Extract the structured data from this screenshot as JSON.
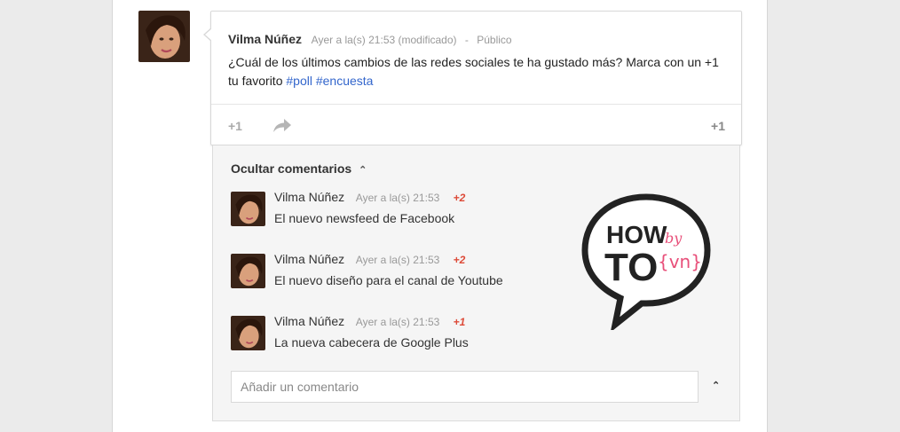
{
  "post": {
    "author": "Vilma Núñez",
    "timestamp": "Ayer a la(s) 21:53 (modificado)",
    "separator": "-",
    "visibility": "Público",
    "text_plain": "¿Cuál de los últimos cambios de las redes sociales te ha gustado más? Marca con un +1 tu favorito",
    "hashtags": [
      "#poll",
      "#encuesta"
    ],
    "plus_one_label": "+1",
    "share_icon": "share-arrow-icon",
    "plus_count": "+1"
  },
  "comments_section": {
    "hide_label": "Ocultar comentarios",
    "hide_icon": "double-chevron-up-icon",
    "items": [
      {
        "author": "Vilma Núñez",
        "timestamp": "Ayer a la(s) 21:53",
        "plus": "+2",
        "text": "El nuevo newsfeed de Facebook"
      },
      {
        "author": "Vilma Núñez",
        "timestamp": "Ayer a la(s) 21:53",
        "plus": "+2",
        "text": "El nuevo diseño para el canal de Youtube"
      },
      {
        "author": "Vilma Núñez",
        "timestamp": "Ayer a la(s) 21:53",
        "plus": "+1",
        "text": "La nueva cabecera de Google Plus"
      }
    ],
    "add_comment_placeholder": "Añadir un comentario",
    "collapse_icon": "double-chevron-up-icon"
  },
  "logo": {
    "line1": "HOW",
    "line2": "TO",
    "by": "by",
    "vn": "{vn}",
    "accent_color": "#e8507a"
  },
  "colors": {
    "hashtag": "#3366cc",
    "plus_badge": "#dd4b39"
  }
}
